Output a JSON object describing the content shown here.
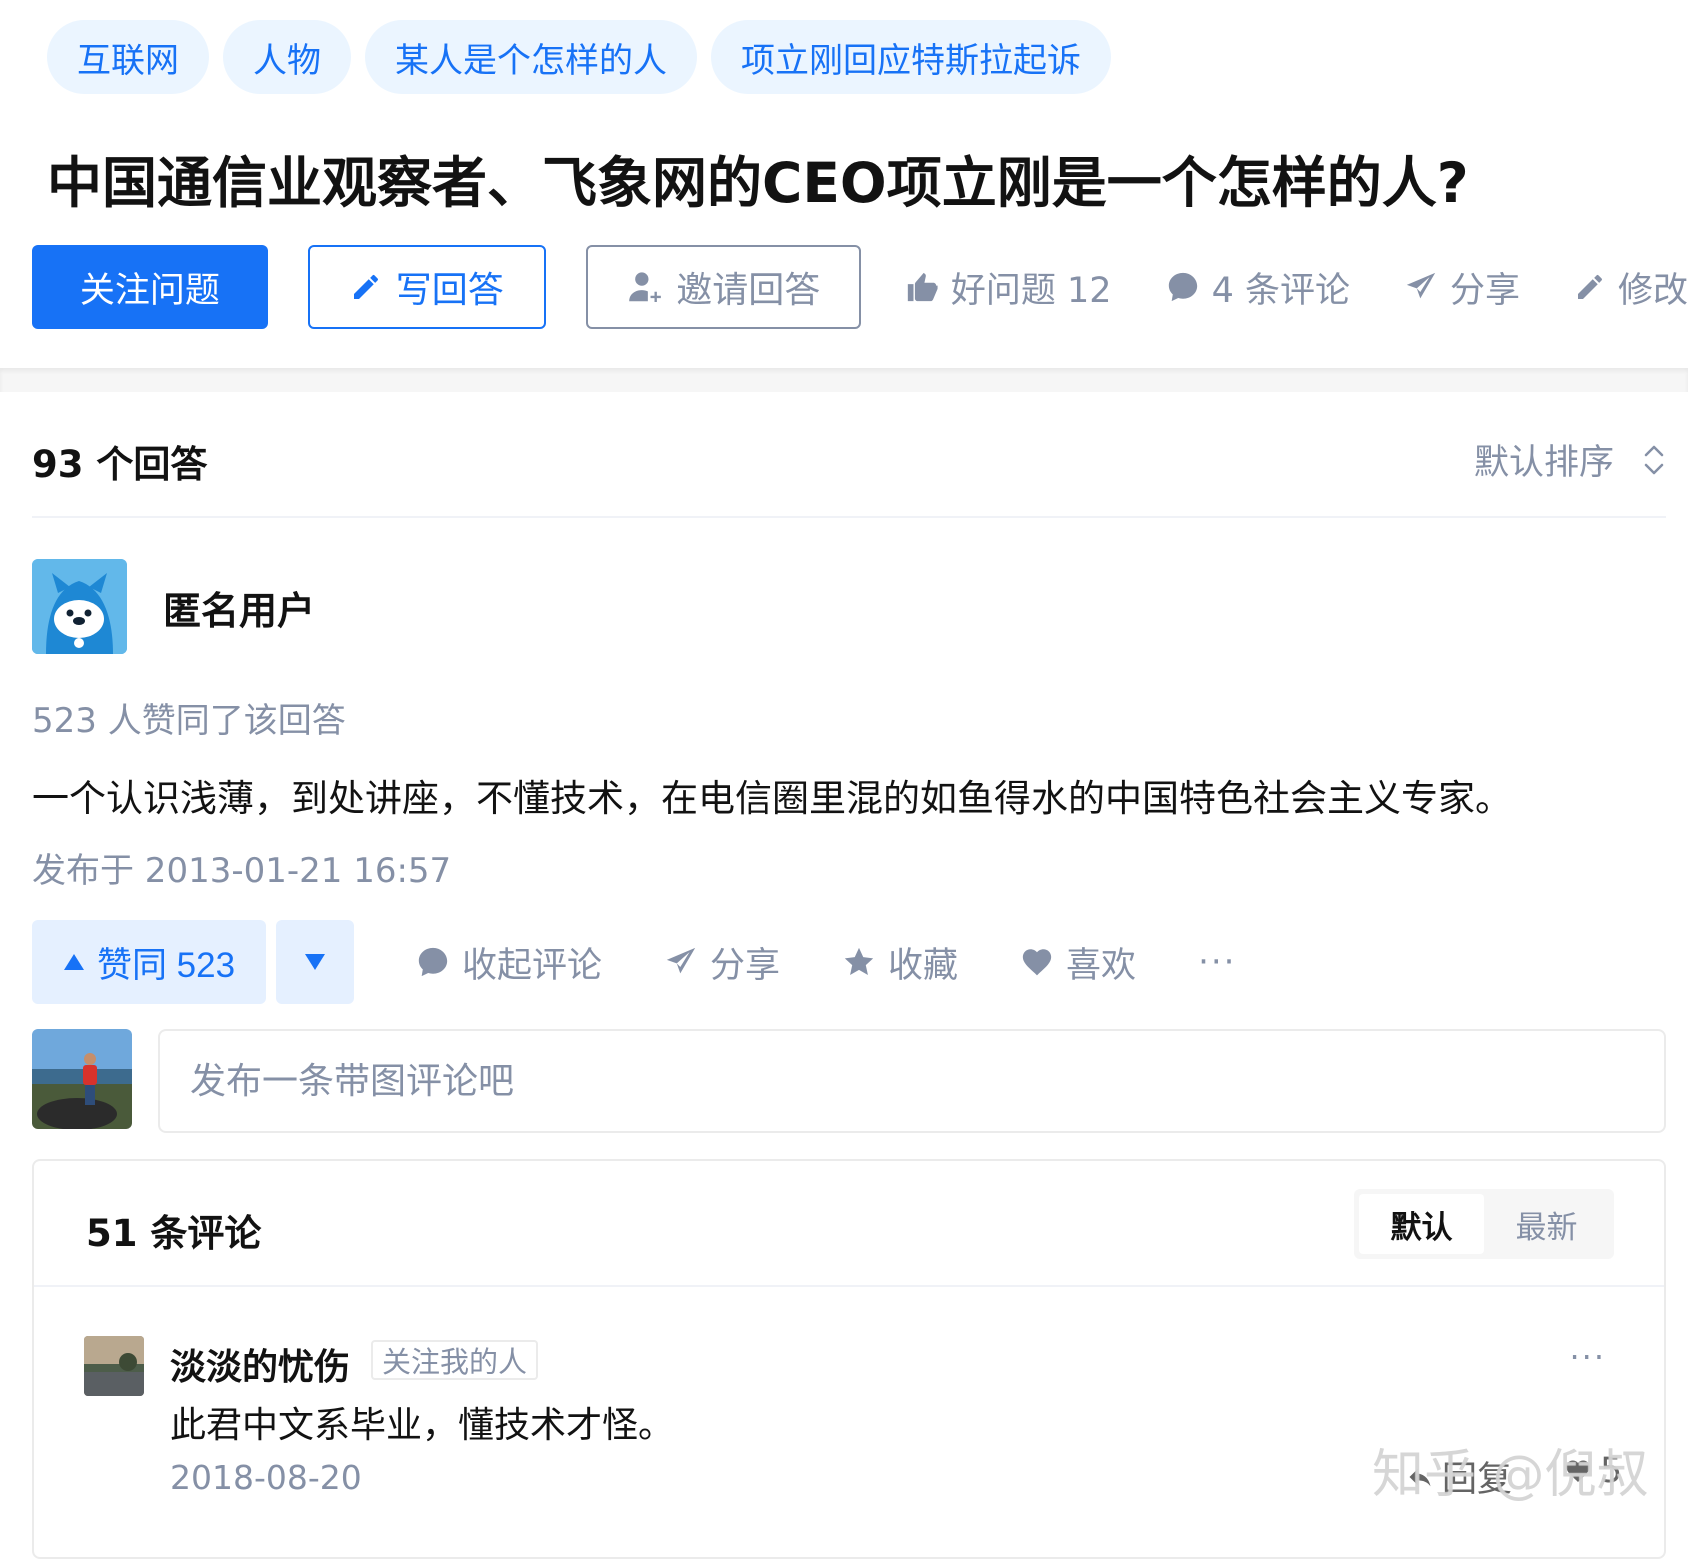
{
  "topics": [
    "互联网",
    "人物",
    "某人是个怎样的人",
    "项立刚回应特斯拉起诉"
  ],
  "question": {
    "title": "中国通信业观察者、飞象网的CEO项立刚是一个怎样的人?",
    "follow_label": "关注问题",
    "write_label": "写回答",
    "invite_label": "邀请回答",
    "good_question_label": "好问题 12",
    "comments_label": "4 条评论",
    "share_label": "分享",
    "edit_label": "修改"
  },
  "answers": {
    "count_label": "93 个回答",
    "sort_label": "默认排序"
  },
  "answer": {
    "author": "匿名用户",
    "votes_line": "523 人赞同了该回答",
    "text": "一个认识浅薄，到处讲座，不懂技术，在电信圈里混的如鱼得水的中国特色社会主义专家。",
    "publish_time": "发布于 2013-01-21 16:57",
    "upvote_label": "赞同 523",
    "collapse_comments_label": "收起评论",
    "share_label": "分享",
    "collect_label": "收藏",
    "like_label": "喜欢",
    "more_label": "···"
  },
  "composer": {
    "placeholder": "发布一条带图评论吧"
  },
  "comments": {
    "count_label": "51 条评论",
    "sort_default": "默认",
    "sort_latest": "最新",
    "items": [
      {
        "author": "淡淡的忧伤",
        "tag": "关注我的人",
        "text": "此君中文系毕业，懂技术才怪。",
        "time": "2018-08-20",
        "reply_label": "回复",
        "like_count": "5",
        "more_label": "···"
      }
    ]
  },
  "watermark": "知乎 @倪叔",
  "colors": {
    "brand_blue": "#1772f6",
    "topic_bg": "#ebf5ff",
    "muted_text": "#8590a6",
    "vote_bg": "#e5f0ff"
  }
}
